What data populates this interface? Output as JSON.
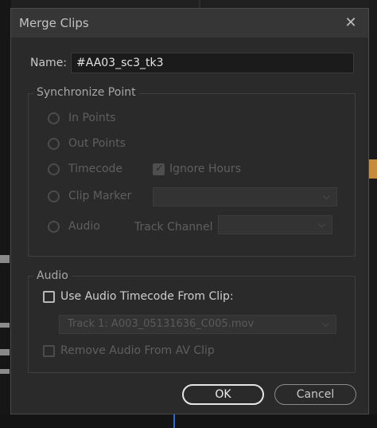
{
  "dialog": {
    "title": "Merge Clips",
    "close_icon": "close-icon"
  },
  "name": {
    "label": "Name:",
    "value": "#AA03_sc3_tk3"
  },
  "sync": {
    "title": "Synchronize Point",
    "in_points": "In Points",
    "out_points": "Out Points",
    "timecode": "Timecode",
    "ignore_hours": "Ignore Hours",
    "clip_marker": "Clip Marker",
    "audio": "Audio",
    "track_channel": "Track Channel"
  },
  "audio": {
    "title": "Audio",
    "use_audio_timecode": "Use Audio Timecode From Clip:",
    "track_selected": "Track 1: A003_05131636_C005.mov",
    "remove_audio": "Remove Audio From AV Clip"
  },
  "buttons": {
    "ok": "OK",
    "cancel": "Cancel"
  }
}
